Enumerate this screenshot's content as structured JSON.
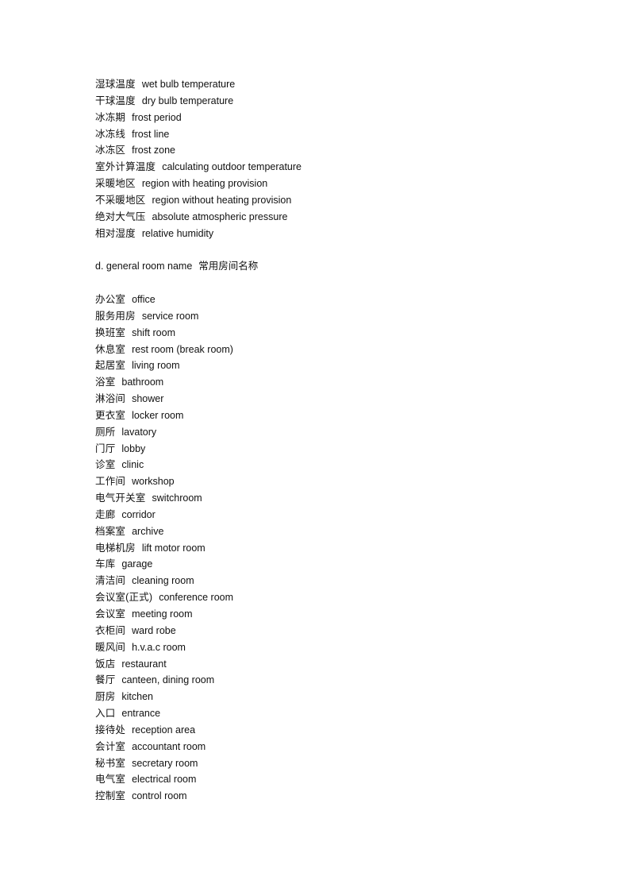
{
  "section_c_terms": [
    {
      "zh": "湿球温度",
      "en": "wet bulb temperature"
    },
    {
      "zh": "干球温度",
      "en": "dry bulb temperature"
    },
    {
      "zh": "冰冻期",
      "en": "frost period"
    },
    {
      "zh": "冰冻线",
      "en": "frost line"
    },
    {
      "zh": "冰冻区",
      "en": "frost zone"
    },
    {
      "zh": "室外计算温度",
      "en": "calculating outdoor temperature"
    },
    {
      "zh": "采暖地区",
      "en": "region with heating provision"
    },
    {
      "zh": "不采暖地区",
      "en": "region without heating provision"
    },
    {
      "zh": "绝对大气压",
      "en": "absolute atmospheric pressure"
    },
    {
      "zh": "相对湿度",
      "en": "relative humidity"
    }
  ],
  "section_d": {
    "heading_en": "d. general room name",
    "heading_zh": "常用房间名称",
    "terms": [
      {
        "zh": "办公室",
        "en": "office"
      },
      {
        "zh": "服务用房",
        "en": "service room"
      },
      {
        "zh": "换班室",
        "en": "shift room"
      },
      {
        "zh": "休息室",
        "en": "rest room (break room)"
      },
      {
        "zh": "起居室",
        "en": "living room"
      },
      {
        "zh": "浴室",
        "en": "bathroom"
      },
      {
        "zh": "淋浴间",
        "en": "shower"
      },
      {
        "zh": "更衣室",
        "en": "locker room"
      },
      {
        "zh": "厕所",
        "en": "lavatory"
      },
      {
        "zh": "门厅",
        "en": "lobby"
      },
      {
        "zh": "诊室",
        "en": "clinic"
      },
      {
        "zh": "工作间",
        "en": "workshop"
      },
      {
        "zh": "电气开关室",
        "en": "switchroom"
      },
      {
        "zh": "走廊",
        "en": "corridor"
      },
      {
        "zh": "档案室",
        "en": "archive"
      },
      {
        "zh": "电梯机房",
        "en": "lift motor room"
      },
      {
        "zh": "车库",
        "en": "garage"
      },
      {
        "zh": "清洁间",
        "en": "cleaning room"
      },
      {
        "zh": "会议室(正式)",
        "en": "conference room"
      },
      {
        "zh": "会议室",
        "en": "meeting room"
      },
      {
        "zh": "衣柜间",
        "en": "ward robe"
      },
      {
        "zh": "暖风间",
        "en": "h.v.a.c room"
      },
      {
        "zh": "饭店",
        "en": "restaurant"
      },
      {
        "zh": "餐厅",
        "en": "canteen, dining room"
      },
      {
        "zh": "厨房",
        "en": "kitchen"
      },
      {
        "zh": "入口",
        "en": "entrance"
      },
      {
        "zh": "接待处",
        "en": "reception area"
      },
      {
        "zh": "会计室",
        "en": "accountant room"
      },
      {
        "zh": "秘书室",
        "en": "secretary room"
      },
      {
        "zh": "电气室",
        "en": "electrical room"
      },
      {
        "zh": "控制室",
        "en": "control room"
      }
    ]
  }
}
